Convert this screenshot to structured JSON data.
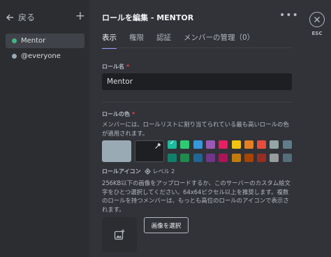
{
  "sidebar": {
    "back_label": "戻る",
    "roles": [
      {
        "label": "Mentor",
        "color": "#43b581",
        "active": true
      },
      {
        "label": "@everyone",
        "color": "#99aab5",
        "active": false
      }
    ]
  },
  "header": {
    "title": "ロールを編集 - MENTOR",
    "more_icon": "ellipsis-icon"
  },
  "tabs": [
    {
      "label": "表示",
      "active": true
    },
    {
      "label": "権限",
      "active": false
    },
    {
      "label": "認証",
      "active": false
    },
    {
      "label": "メンバーの管理（0）",
      "active": false
    }
  ],
  "role_name": {
    "label": "ロール名",
    "required_mark": "*",
    "value": "Mentor"
  },
  "role_color": {
    "label": "ロールの色",
    "required_mark": "*",
    "description": "メンバーには、ロールリストに割り当てられている最も高いロールの色が適用されます。",
    "default_color": "#99aab5",
    "swatches_top": [
      "#1abc9c",
      "#2ecc71",
      "#3498db",
      "#9b59b6",
      "#e91e63",
      "#f1c40f",
      "#e67e22",
      "#e74c3c",
      "#95a5a6",
      "#607d8b"
    ],
    "swatches_bottom": [
      "#11806a",
      "#1f8b4c",
      "#206694",
      "#71368a",
      "#ad1457",
      "#c27c0e",
      "#a84300",
      "#992d22",
      "#979c9f",
      "#546e7a"
    ],
    "selected_index": 0,
    "check_mark": "✓"
  },
  "role_icon": {
    "label": "ロールアイコン",
    "boost_label": "レベル 2",
    "description": "256KB以下の画像をアップロードするか、このサーバーのカスタム絵文字をひとつ選択してください。64x64ピクセル以上を推奨します。複数のロールを持つメンバーは、もっとも高位のロールのアイコンで表示されます。",
    "select_button": "画像を選択"
  },
  "close": {
    "esc_label": "ESC"
  }
}
